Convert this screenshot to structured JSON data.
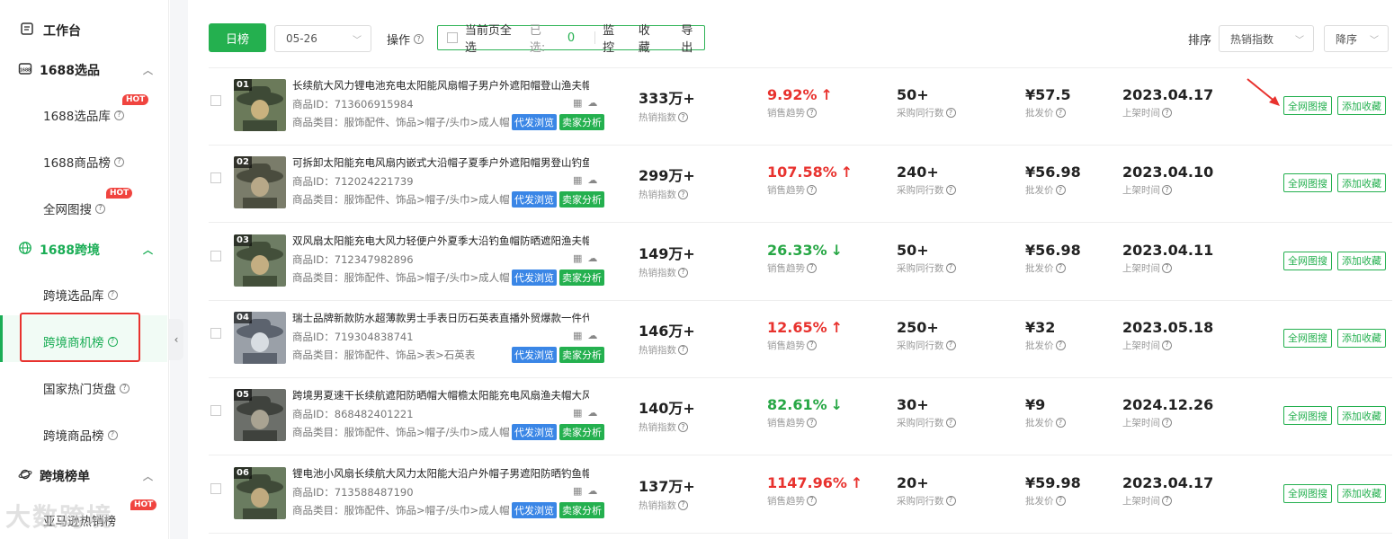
{
  "sidebar": {
    "top": {
      "label": "工作台",
      "icon": "document-icon"
    },
    "groups": [
      {
        "label": "1688选品",
        "icon": "1688-box-icon",
        "items": [
          {
            "label": "1688选品库",
            "hot": "HOT"
          },
          {
            "label": "1688商品榜"
          },
          {
            "label": "全网图搜",
            "hot": "HOT"
          }
        ]
      },
      {
        "label": "1688跨境",
        "icon": "globe-icon",
        "items": [
          {
            "label": "跨境选品库"
          },
          {
            "label": "跨境商机榜"
          },
          {
            "label": "国家热门货盘"
          },
          {
            "label": "跨境商品榜"
          }
        ]
      },
      {
        "label": "跨境榜单",
        "icon": "planet-icon",
        "items": [
          {
            "label": "亚马逊热销榜",
            "hot": "HOT"
          }
        ]
      }
    ],
    "watermark": "大数跨境"
  },
  "toolbar": {
    "rank_button": "日榜",
    "date_value": "05-26",
    "ops_label": "操作",
    "select_page": "当前页全选",
    "selected_label": "已选:",
    "selected_count": "0",
    "monitor": "监控",
    "favorite": "收藏",
    "export": "导出",
    "sort_label": "排序",
    "sort_field": "热销指数",
    "sort_order": "降序"
  },
  "labels": {
    "hot_index": "热销指数",
    "sales_trend": "销售趋势",
    "peers": "采购同行数",
    "wholesale": "批发价",
    "listed": "上架时间",
    "tag_dropship": "代发浏览",
    "tag_seller": "卖家分析",
    "btn_image_search": "全网图搜",
    "btn_add_fav": "添加收藏"
  },
  "products": [
    {
      "rank": "01",
      "title": "长续航大风力锂电池充电太阳能风扇帽子男户外遮阳帽登山渔夫帽薄",
      "id": "商品ID：713606915984",
      "category": "商品类目：服饰配件、饰品>帽子/头巾>成人帽",
      "hot": "333万+",
      "trend": "9.92%",
      "dir": "up",
      "peers": "50+",
      "price": "¥57.5",
      "date": "2023.04.17"
    },
    {
      "rank": "02",
      "title": "可拆卸太阳能充电风扇内嵌式大沿帽子夏季户外遮阳帽男登山钓鱼帽",
      "id": "商品ID：712024221739",
      "category": "商品类目：服饰配件、饰品>帽子/头巾>成人帽",
      "hot": "299万+",
      "trend": "107.58%",
      "dir": "up",
      "peers": "240+",
      "price": "¥56.98",
      "date": "2023.04.10"
    },
    {
      "rank": "03",
      "title": "双风扇太阳能充电大风力轻便户外夏季大沿钓鱼帽防晒遮阳渔夫帽男",
      "id": "商品ID：712347982896",
      "category": "商品类目：服饰配件、饰品>帽子/头巾>成人帽",
      "hot": "149万+",
      "trend": "26.33%",
      "dir": "down",
      "peers": "50+",
      "price": "¥56.98",
      "date": "2023.04.11"
    },
    {
      "rank": "04",
      "title": "瑞士品牌新款防水超薄款男士手表日历石英表直播外贸爆款一件代发",
      "id": "商品ID：719304838741",
      "category": "商品类目：服饰配件、饰品>表>石英表",
      "hot": "146万+",
      "trend": "12.65%",
      "dir": "up",
      "peers": "250+",
      "price": "¥32",
      "date": "2023.05.18"
    },
    {
      "rank": "05",
      "title": "跨境男夏速干长续航遮阳防晒帽大帽檐太阳能充电风扇渔夫帽大风力",
      "id": "商品ID：868482401221",
      "category": "商品类目：服饰配件、饰品>帽子/头巾>成人帽",
      "hot": "140万+",
      "trend": "82.61%",
      "dir": "down",
      "peers": "30+",
      "price": "¥9",
      "date": "2024.12.26"
    },
    {
      "rank": "06",
      "title": "锂电池小风扇长续航大风力太阳能大沿户外帽子男遮阳防晒钓鱼帽夏",
      "id": "商品ID：713588487190",
      "category": "商品类目：服饰配件、饰品>帽子/头巾>成人帽",
      "hot": "137万+",
      "trend": "1147.96%",
      "dir": "up",
      "peers": "20+",
      "price": "¥59.98",
      "date": "2023.04.17"
    }
  ]
}
